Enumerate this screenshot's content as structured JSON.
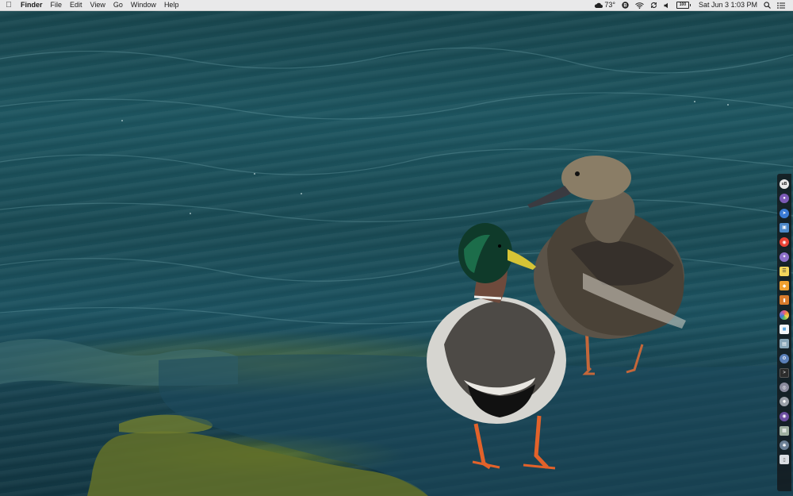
{
  "menubar": {
    "apple_icon": "apple-logo-icon",
    "app_name": "Finder",
    "menus": [
      "File",
      "Edit",
      "View",
      "Go",
      "Window",
      "Help"
    ],
    "status": {
      "temperature": "73°",
      "battery": "100",
      "datetime": "Sat Jun 3  1:03 PM"
    }
  },
  "dock": {
    "items": [
      {
        "icon": "ublock-icon",
        "label": "uB",
        "color": "#e8e8e8"
      },
      {
        "icon": "tor-browser-icon",
        "label": "",
        "color": "#7b59b5"
      },
      {
        "icon": "safari-icon",
        "label": "",
        "color": "#3a7bd5"
      },
      {
        "icon": "preview-icon",
        "label": "",
        "color": "#4d89c9"
      },
      {
        "icon": "chrome-icon",
        "label": "",
        "color": "#e94235"
      },
      {
        "icon": "xcode-icon",
        "label": "",
        "color": "#8c6fc9"
      },
      {
        "icon": "notes-icon",
        "label": "",
        "color": "#f3d55b"
      },
      {
        "icon": "sketch-icon",
        "label": "",
        "color": "#f0a030"
      },
      {
        "icon": "numbers-icon",
        "label": "",
        "color": "#d87b2c"
      },
      {
        "icon": "photos-icon",
        "label": "",
        "color": "#e35a86"
      },
      {
        "icon": "finder-icon",
        "label": "",
        "color": "#5da8e0"
      },
      {
        "icon": "document-icon",
        "label": "",
        "color": "#88a6b8"
      },
      {
        "icon": "system-preferences-icon",
        "label": "",
        "color": "#5a7fb8"
      },
      {
        "icon": "terminal-icon",
        "label": "",
        "color": "#2c2c2c"
      },
      {
        "icon": "disk-utility-icon",
        "label": "",
        "color": "#8a8a9c"
      },
      {
        "icon": "settings-gear-icon",
        "label": "",
        "color": "#9ba0a8"
      },
      {
        "icon": "onion-icon",
        "label": "",
        "color": "#6b4ea0"
      },
      {
        "icon": "archive-icon",
        "label": "",
        "color": "#9fb0a0"
      },
      {
        "icon": "app-store-icon",
        "label": "",
        "color": "#6b7f95"
      },
      {
        "icon": "trash-icon",
        "label": "",
        "color": "#d9dde2"
      }
    ]
  }
}
